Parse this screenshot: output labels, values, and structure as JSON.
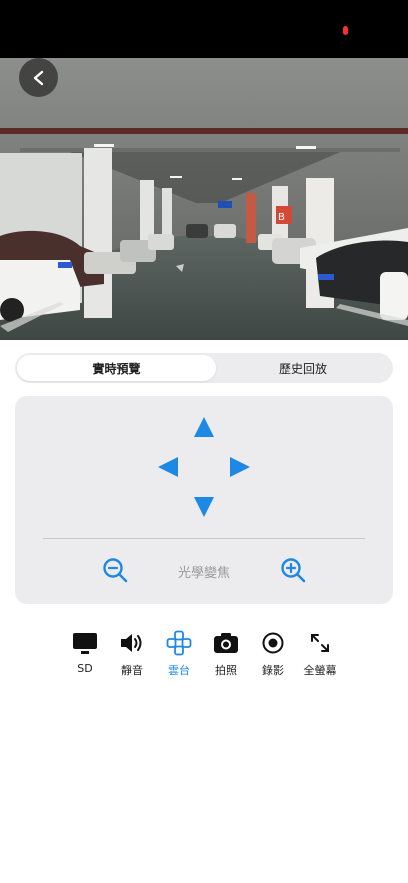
{
  "colors": {
    "accent": "#1e88e5",
    "panel": "#ececee",
    "text": "#222222",
    "muted": "#9a9a9e",
    "recording": "#ff2d2d"
  },
  "video": {
    "signs": [
      "B",
      "B"
    ]
  },
  "tabs": [
    {
      "label": "實時預覽",
      "active": true
    },
    {
      "label": "歷史回放",
      "active": false
    }
  ],
  "ptz": {
    "zoom_label": "光學變焦"
  },
  "toolbar": [
    {
      "label": "SD",
      "icon": "monitor-icon",
      "active": false
    },
    {
      "label": "靜音",
      "icon": "speaker-icon",
      "active": false
    },
    {
      "label": "雲台",
      "icon": "gamepad-icon",
      "active": true
    },
    {
      "label": "拍照",
      "icon": "camera-icon",
      "active": false
    },
    {
      "label": "錄影",
      "icon": "record-icon",
      "active": false
    },
    {
      "label": "全螢幕",
      "icon": "fullscreen-icon",
      "active": false
    }
  ]
}
